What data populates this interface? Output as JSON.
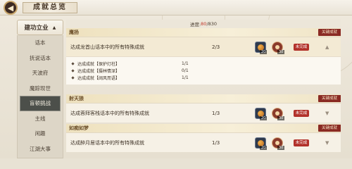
{
  "header": {
    "title": "成就总览"
  },
  "sidebar": {
    "category": "建功立业",
    "items": [
      {
        "label": "话本",
        "active": false
      },
      {
        "label": "抚说话本",
        "active": false
      },
      {
        "label": "天波府",
        "active": false
      },
      {
        "label": "魔踪现世",
        "active": false
      },
      {
        "label": "盲顿挑战",
        "active": true
      },
      {
        "label": "主线",
        "active": false
      },
      {
        "label": "闲趣",
        "active": false
      },
      {
        "label": "江湖大事",
        "active": false
      }
    ]
  },
  "progress": {
    "label": "进度:",
    "current": "80",
    "total": "/830"
  },
  "peek_values": [
    "20",
    "30"
  ],
  "sections": [
    {
      "title": "鹰扬",
      "key_tag": "关键成就",
      "row": {
        "desc": "达成龙首山话本中的所有特殊成就",
        "count": "2/3",
        "reward1": "20",
        "reward2": "30",
        "status": "未完成",
        "chevron": "▲"
      },
      "subs": [
        {
          "desc": "达成成就【保护灯柱】",
          "count": "1/1"
        },
        {
          "desc": "达成成就【摄林情深】",
          "count": "0/1"
        },
        {
          "desc": "达成成就【阔风而语】",
          "count": "1/1"
        }
      ]
    },
    {
      "title": "射天狼",
      "key_tag": "关键成就",
      "row": {
        "desc": "达成蓉拜客栈话本中的所有特殊成就",
        "count": "1/3",
        "reward1": "20",
        "reward2": "30",
        "status": "未完成",
        "chevron": "▼"
      }
    },
    {
      "title": "如痴如梦",
      "key_tag": "关键成就",
      "row": {
        "desc": "达成醉月居话本中的所有特殊成就",
        "count": "1/3",
        "reward1": "20",
        "reward2": "30",
        "status": "未完成",
        "chevron": "▼"
      }
    }
  ],
  "colors": {
    "accent": "#b2312a",
    "active_tab": "#4c4f4a",
    "section_head": "#f2e6c6"
  }
}
